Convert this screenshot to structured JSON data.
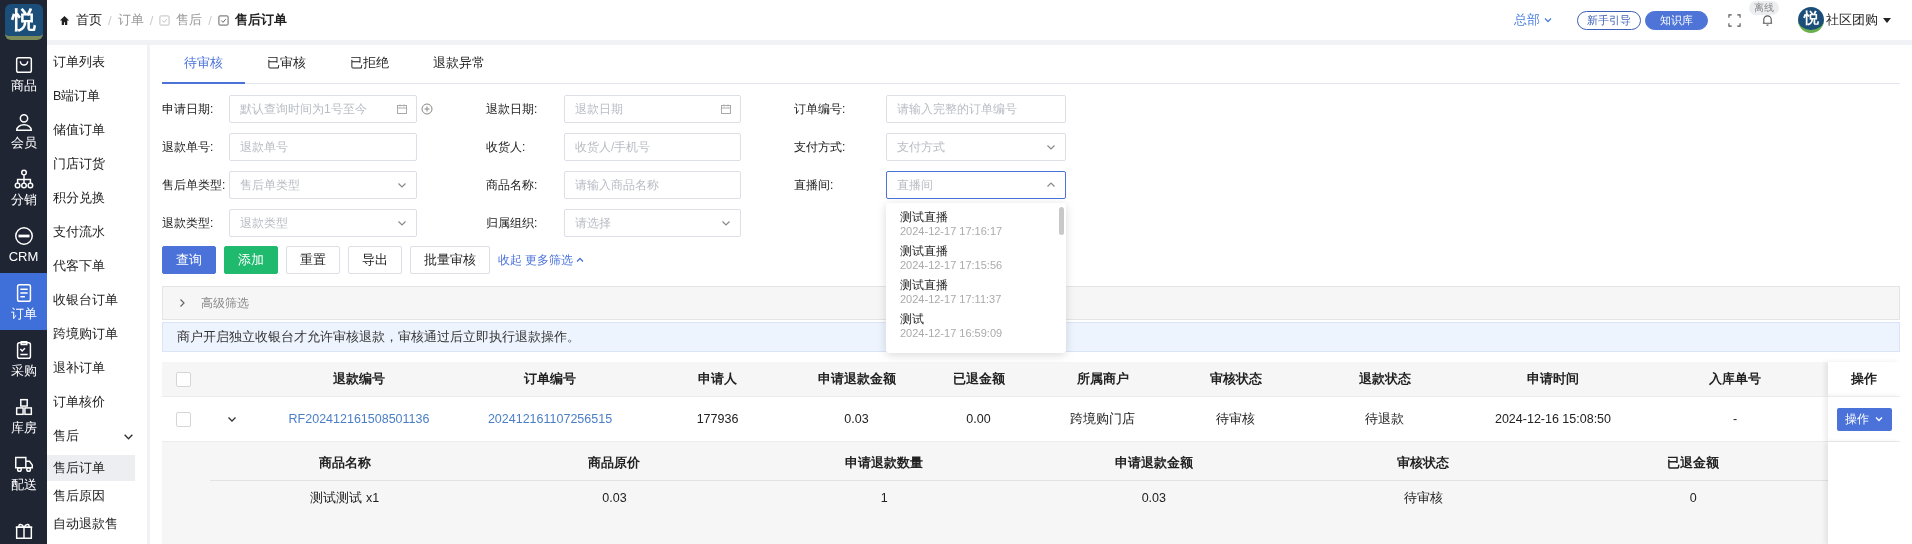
{
  "rail": {
    "logo": "悦",
    "items": [
      {
        "label": "商品",
        "selected": false
      },
      {
        "label": "会员",
        "selected": false
      },
      {
        "label": "分销",
        "selected": false
      },
      {
        "label": "CRM",
        "selected": false
      },
      {
        "label": "订单",
        "selected": true
      },
      {
        "label": "采购",
        "selected": false
      },
      {
        "label": "库房",
        "selected": false
      },
      {
        "label": "配送",
        "selected": false
      }
    ]
  },
  "breadcrumb": [
    {
      "label": "首页",
      "current": false
    },
    {
      "label": "订单",
      "current": false
    },
    {
      "label": "售后",
      "current": false
    },
    {
      "label": "售后订单",
      "current": true
    }
  ],
  "breadcrumb_separator": "/",
  "topbar": {
    "org": "总部",
    "guide": "新手引导",
    "knowledge": "知识库",
    "status_badge": "离线",
    "avatar": "悦",
    "user": "社区团购"
  },
  "submenu": [
    {
      "label": "订单列表",
      "selected": false
    },
    {
      "label": "B端订单",
      "selected": false
    },
    {
      "label": "储值订单",
      "selected": false
    },
    {
      "label": "门店订货",
      "selected": false
    },
    {
      "label": "积分兑换",
      "selected": false
    },
    {
      "label": "支付流水",
      "selected": false
    },
    {
      "label": "代客下单",
      "selected": false
    },
    {
      "label": "收银台订单",
      "selected": false
    },
    {
      "label": "跨境购订单",
      "selected": false
    },
    {
      "label": "退补订单",
      "selected": false
    },
    {
      "label": "订单核价",
      "selected": false
    },
    {
      "label": "售后",
      "selected": false,
      "expanded": true,
      "children": [
        {
          "label": "售后订单",
          "selected": true
        },
        {
          "label": "售后原因",
          "selected": false
        },
        {
          "label": "自动退款售",
          "selected": false
        }
      ]
    }
  ],
  "tabs": [
    {
      "label": "待审核",
      "selected": true
    },
    {
      "label": "已审核",
      "selected": false
    },
    {
      "label": "已拒绝",
      "selected": false
    },
    {
      "label": "退款异常",
      "selected": false
    }
  ],
  "filters": [
    {
      "label": "申请日期:",
      "placeholder": "默认查询时间为1号至今",
      "kind": "datepair",
      "open": false
    },
    {
      "label": "退款日期:",
      "placeholder": "退款日期",
      "kind": "date",
      "open": false
    },
    {
      "label": "订单编号:",
      "placeholder": "请输入完整的订单编号",
      "kind": "text",
      "open": false
    },
    {
      "label": "退款单号:",
      "placeholder": "退款单号",
      "kind": "text",
      "open": false
    },
    {
      "label": "收货人:",
      "placeholder": "收货人/手机号",
      "kind": "text",
      "open": false
    },
    {
      "label": "支付方式:",
      "placeholder": "支付方式",
      "kind": "select",
      "open": false
    },
    {
      "label": "售后单类型:",
      "placeholder": "售后单类型",
      "kind": "select",
      "open": false
    },
    {
      "label": "商品名称:",
      "placeholder": "请输入商品名称",
      "kind": "text",
      "open": false
    },
    {
      "label": "直播间:",
      "placeholder": "直播间",
      "kind": "select",
      "open": true,
      "options": [
        {
          "name": "测试直播",
          "time": "2024-12-17 17:16:17"
        },
        {
          "name": "测试直播",
          "time": "2024-12-17 17:15:56"
        },
        {
          "name": "测试直播",
          "time": "2024-12-17 17:11:37"
        },
        {
          "name": "测试",
          "time": "2024-12-17 16:59:09"
        }
      ]
    },
    {
      "label": "退款类型:",
      "placeholder": "退款类型",
      "kind": "select",
      "open": false
    },
    {
      "label": "归属组织:",
      "placeholder": "请选择",
      "kind": "select",
      "open": false
    }
  ],
  "buttons": [
    {
      "label": "查询",
      "kind": "primary"
    },
    {
      "label": "添加",
      "kind": "success"
    },
    {
      "label": "重置",
      "kind": "default"
    },
    {
      "label": "导出",
      "kind": "default"
    },
    {
      "label": "批量审核",
      "kind": "default"
    }
  ],
  "filter_toggle": "收起 更多筛选",
  "advanced_filter": {
    "label": "高级筛选",
    "expanded": false
  },
  "notice": "商户开启独立收银台才允许审核退款，审核通过后立即执行退款操作。",
  "table": {
    "header_checked": false,
    "columns": [
      {
        "title": "退款编号",
        "link": true
      },
      {
        "title": "订单编号",
        "link": true
      },
      {
        "title": "申请人",
        "link": false
      },
      {
        "title": "申请退款金额",
        "link": false
      },
      {
        "title": "已退金额",
        "link": false
      },
      {
        "title": "所属商户",
        "link": false
      },
      {
        "title": "审核状态",
        "link": false
      },
      {
        "title": "退款状态",
        "link": false
      },
      {
        "title": "申请时间",
        "link": false
      },
      {
        "title": "入库单号",
        "link": false
      }
    ],
    "action_title": "操作",
    "rows": [
      {
        "checked": false,
        "expanded": true,
        "action": "操作",
        "cells": [
          "RF202412161508501136",
          "202412161107256515",
          "177936",
          "0.03",
          "0.00",
          "跨境购门店",
          "待审核",
          "待退款",
          "2024-12-16 15:08:50",
          "-"
        ],
        "details": {
          "columns": [
            "商品名称",
            "商品原价",
            "申请退款数量",
            "申请退款金额",
            "审核状态",
            "已退金额"
          ],
          "rows": [
            [
              "测试测试 x1",
              "0.03",
              "1",
              "0.03",
              "待审核",
              "0"
            ]
          ]
        }
      }
    ]
  }
}
